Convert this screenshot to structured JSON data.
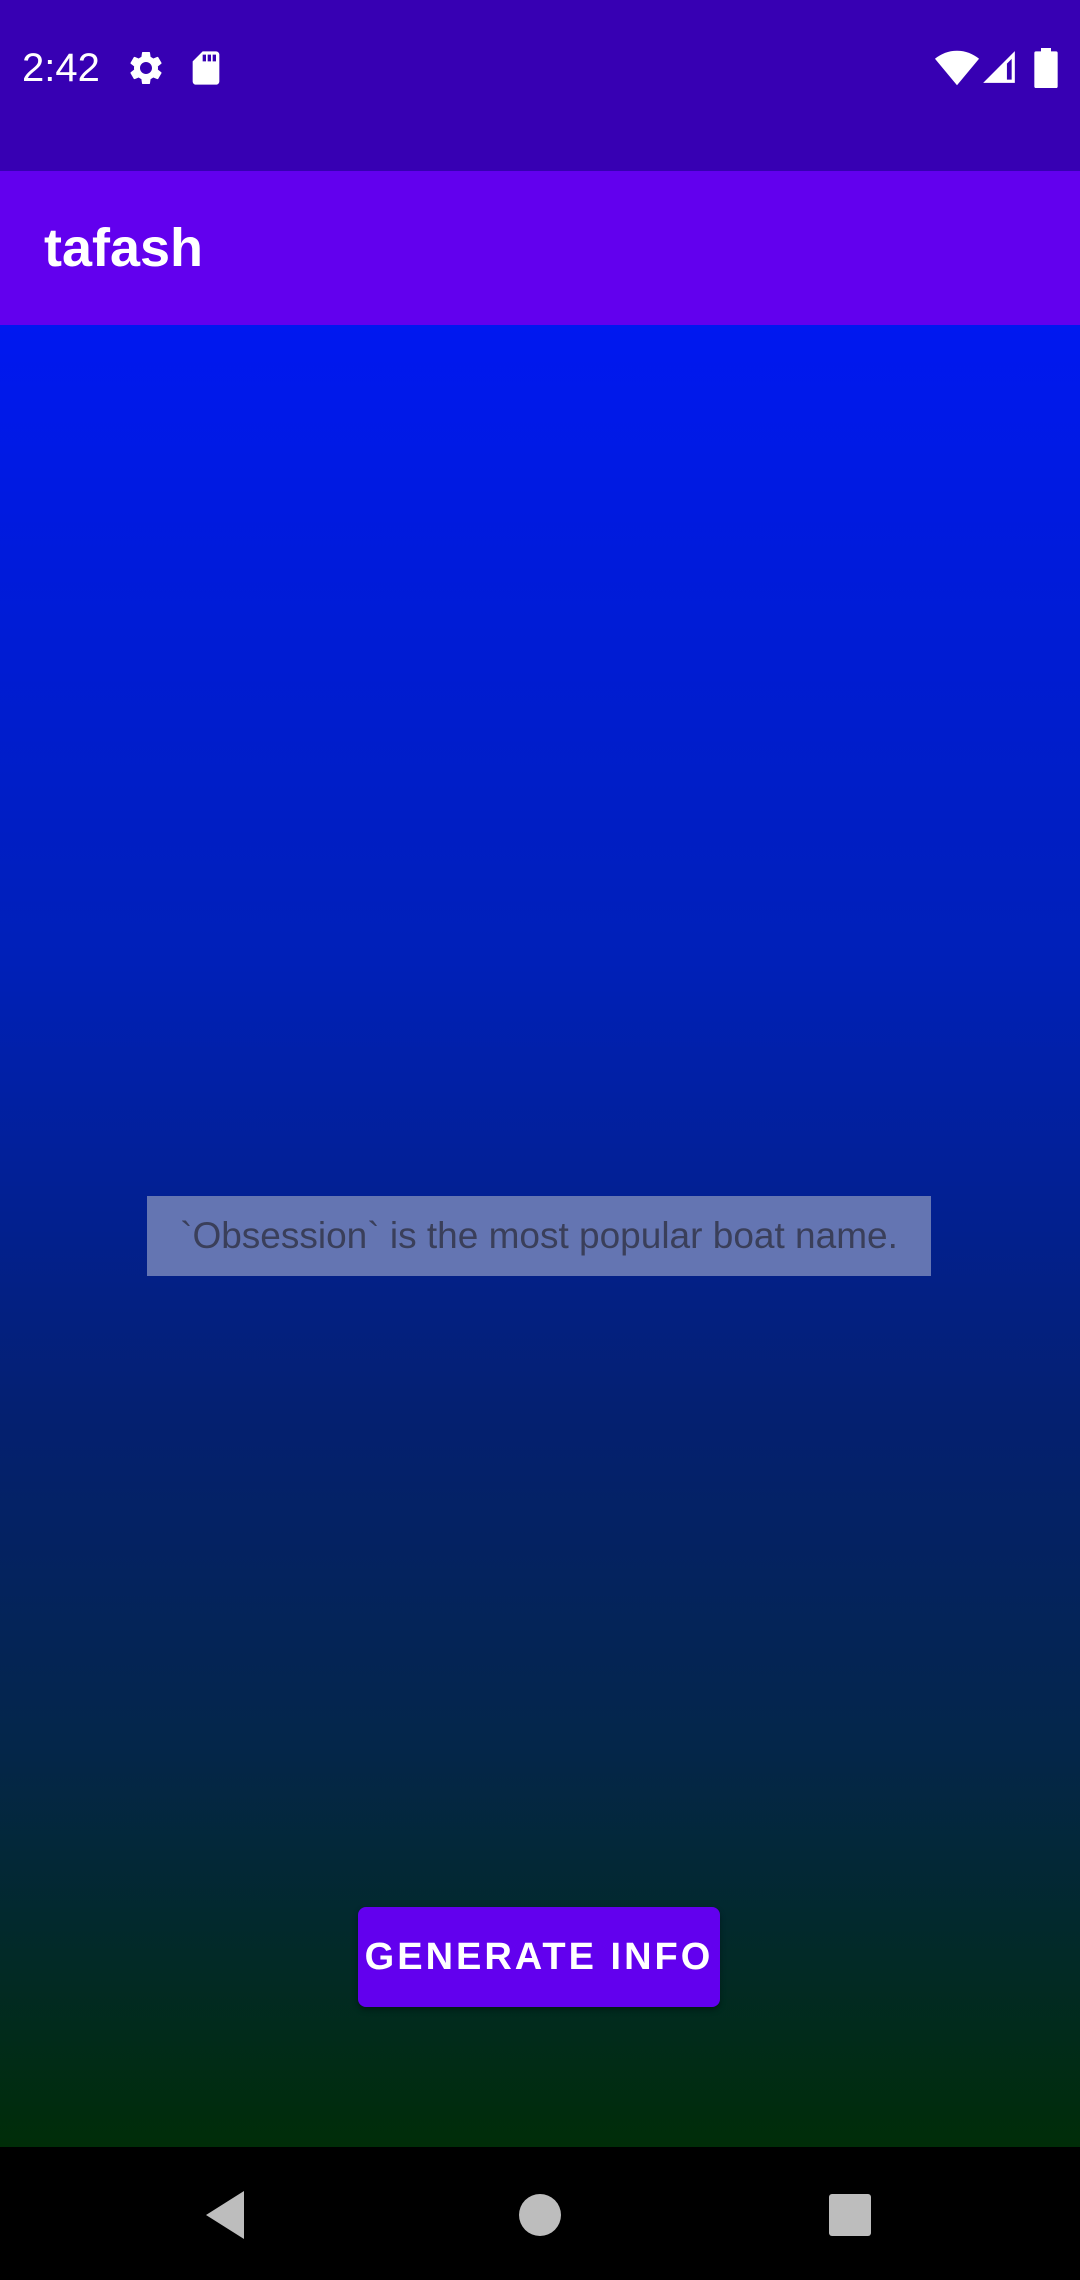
{
  "status_bar": {
    "time": "2:42",
    "icons": [
      "settings-icon",
      "sd-card-icon",
      "wifi-icon",
      "cell-signal-icon",
      "battery-icon"
    ],
    "background": "#3700B3"
  },
  "app_bar": {
    "title": "tafash",
    "background": "#6200EE"
  },
  "main": {
    "fact": "`Obsession` is the most popular boat name.",
    "button_label": "GENERATE INFO",
    "accent": "#6200EE"
  },
  "nav_bar": {
    "icons": [
      "back-icon",
      "home-icon",
      "recents-icon"
    ]
  }
}
